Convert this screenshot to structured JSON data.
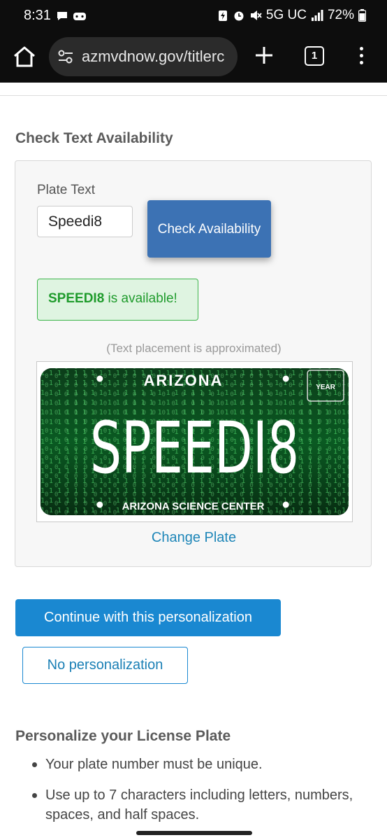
{
  "status_bar": {
    "time": "8:31",
    "network": "5G UC",
    "battery": "72%"
  },
  "browser": {
    "url": "azmvdnow.gov/titlerc",
    "tab_count": "1"
  },
  "page": {
    "section_title": "Check Text Availability",
    "plate_text_label": "Plate Text",
    "plate_text_value": "Speedi8",
    "check_button": "Check Availability",
    "availability_plate": "SPEEDI8",
    "availability_suffix": " is available!",
    "approx_note": "(Text placement is approximated)",
    "plate": {
      "state": "ARIZONA",
      "text": "SPEEDI8",
      "sticker": "YEAR",
      "footer": "ARIZONA SCIENCE CENTER"
    },
    "change_plate": "Change Plate",
    "continue_button": "Continue with this personalization",
    "no_personalization_button": "No personalization",
    "personalize_title": "Personalize your License Plate",
    "bullets": [
      "Your plate number must be unique.",
      "Use up to 7 characters including letters, numbers, spaces, and half spaces."
    ]
  },
  "colors": {
    "primary_button": "#1a88d1",
    "check_button": "#3c72b4",
    "success_text": "#1f9b2c",
    "success_bg": "#dff4e1",
    "link": "#1e86b8"
  }
}
